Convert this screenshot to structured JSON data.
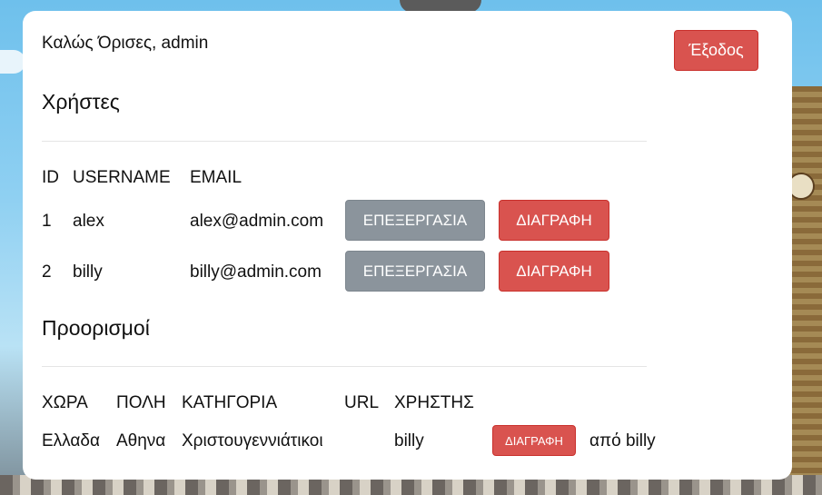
{
  "header": {
    "welcome": "Καλώς Όρισες, admin",
    "logout_label": "Έξοδος"
  },
  "users": {
    "title": "Χρήστες",
    "columns": [
      "ID",
      "USERNAME",
      "EMAIL"
    ],
    "rows": [
      {
        "id": "1",
        "username": "alex",
        "email": "alex@admin.com",
        "edit_label": "ΕΠΕΞΕΡΓΑΣΙΑ",
        "delete_label": "ΔΙΑΓΡΑΦΗ"
      },
      {
        "id": "2",
        "username": "billy",
        "email": "billy@admin.com",
        "edit_label": "ΕΠΕΞΕΡΓΑΣΙΑ",
        "delete_label": "ΔΙΑΓΡΑΦΗ"
      }
    ]
  },
  "destinations": {
    "title": "Προορισμοί",
    "columns": [
      "ΧΩΡΑ",
      "ΠΟΛΗ",
      "ΚΑΤΗΓΟΡΙΑ",
      "URL",
      "ΧΡΗΣΤΗΣ"
    ],
    "rows": [
      {
        "country": "Ελλαδα",
        "city": "Αθηνα",
        "category": "Χριστουγεννιάτικοι",
        "url": "",
        "user": "billy",
        "delete_label": "ΔΙΑΓΡΑΦΗ",
        "by": "από billy"
      }
    ]
  },
  "colors": {
    "danger": "#d9534f",
    "secondary": "#8b949c"
  }
}
